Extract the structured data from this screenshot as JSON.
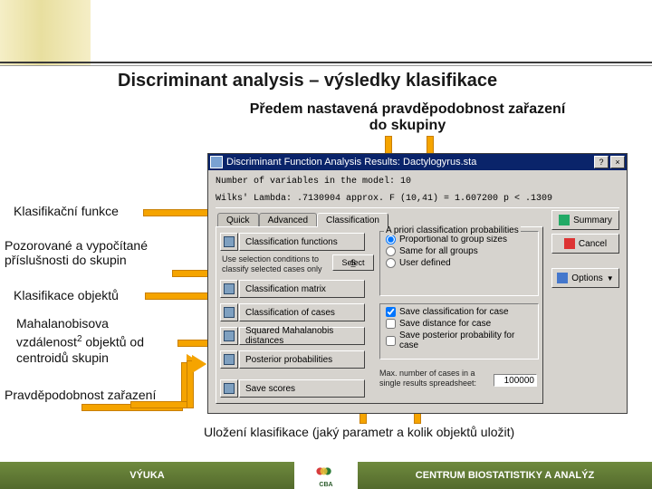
{
  "title": "Discriminant analysis – výsledky klasifikace",
  "subtitle": "Předem nastavená pravděpodobnost zařazení do skupiny",
  "annot": {
    "a1": "Klasifikační funkce",
    "a2": "Pozorované a vypočítané příslušnosti do skupin",
    "a3": "Klasifikace objektů",
    "a4_line1": "Mahalanobisova",
    "a4_line2_a": "vzdálenost",
    "a4_line2_b": " objektů od",
    "a4_line2_sup": "2",
    "a4_line3": "centroidů skupin",
    "a5": "Pravděpodobnost zařazení",
    "bottom": "Uložení klasifikace (jaký parametr a kolik objektů uložit)"
  },
  "dialog": {
    "title": "Discriminant Function Analysis Results: Dactylogyrus.sta",
    "help": "?",
    "close": "×",
    "info1": "Number of variables in the model: 10",
    "info2": "Wilks' Lambda: .7130904    approx. F (10,41) = 1.607200 p <  .1309",
    "tabs": {
      "quick": "Quick",
      "advanced": "Advanced",
      "classification": "Classification"
    },
    "buttons": {
      "b1": "Classification functions",
      "b2": "Classification matrix",
      "b3": "Classification of cases",
      "b4": "Squared Mahalanobis distances",
      "b5": "Posterior probabilities",
      "b6": "Save scores"
    },
    "selbtn": "Select",
    "selhint_l1": "Use selection conditions to",
    "selhint_l2": "classify selected cases only",
    "group1_title": "A priori classification probabilities",
    "radios": {
      "r1": "Proportional to group sizes",
      "r2": "Same for all groups",
      "r3": "User defined"
    },
    "checks": {
      "c1": "Save classification for case",
      "c2": "Save distance for case",
      "c3": "Save posterior probability for case"
    },
    "maxn_l1": "Max. number of cases in a",
    "maxn_l2": "single results spreadsheet:",
    "maxn_val": "100000",
    "right": {
      "summary": "Summary",
      "cancel": "Cancel",
      "options": "Options"
    }
  },
  "footer": {
    "left": "VÝUKA",
    "right": "CENTRUM BIOSTATISTIKY A ANALÝZ",
    "mid": "CBA"
  }
}
